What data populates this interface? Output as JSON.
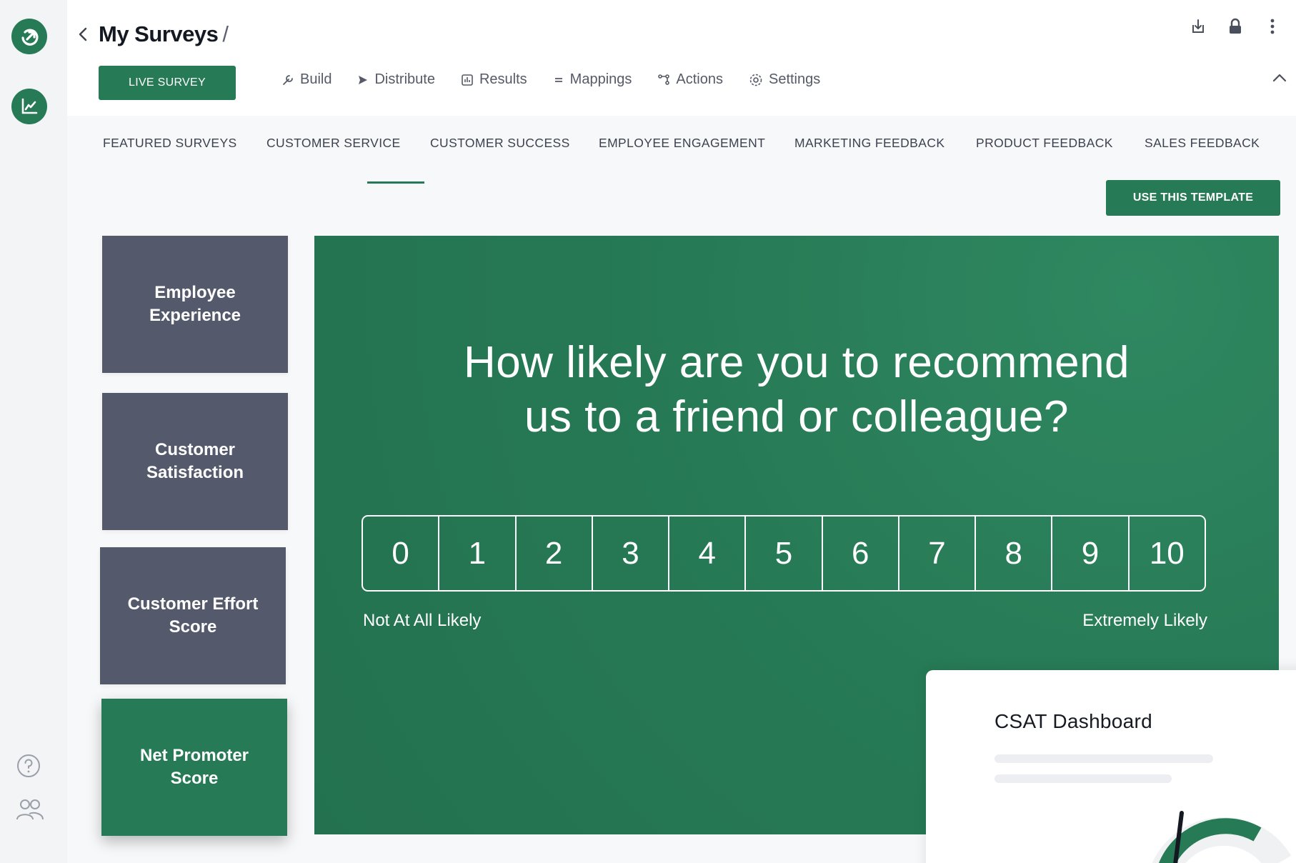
{
  "header": {
    "title": "My Surveys",
    "title_separator": "/",
    "live_button": "LIVE SURVEY",
    "toolbar": [
      {
        "label": "Build",
        "icon": "wrench-icon"
      },
      {
        "label": "Distribute",
        "icon": "send-icon"
      },
      {
        "label": "Results",
        "icon": "results-icon"
      },
      {
        "label": "Mappings",
        "icon": "list-icon"
      },
      {
        "label": "Actions",
        "icon": "workflow-icon"
      },
      {
        "label": "Settings",
        "icon": "gear-icon"
      }
    ],
    "tools": [
      "export-icon",
      "lock-icon",
      "more-vertical-icon"
    ]
  },
  "categories": {
    "tabs": [
      "FEATURED SURVEYS",
      "CUSTOMER SERVICE",
      "CUSTOMER SUCCESS",
      "EMPLOYEE ENGAGEMENT",
      "MARKETING FEEDBACK",
      "PRODUCT FEEDBACK",
      "SALES FEEDBACK"
    ],
    "use_template_button": "USE THIS TEMPLATE"
  },
  "templates": [
    {
      "label": "Employee Experience"
    },
    {
      "label": "Customer Satisfaction"
    },
    {
      "label": "Customer Effort Score"
    },
    {
      "label": "Net Promoter Score",
      "selected": true
    }
  ],
  "preview": {
    "question_line1": "How likely are you to recommend",
    "question_line2": "us to a friend or colleague?",
    "scale": [
      "0",
      "1",
      "2",
      "3",
      "4",
      "5",
      "6",
      "7",
      "8",
      "9",
      "10"
    ],
    "low_label": "Not At All Likely",
    "high_label": "Extremely Likely"
  },
  "csat_card": {
    "title": "CSAT Dashboard"
  },
  "colors": {
    "brand_green": "#267a55",
    "card_slate": "#545a6c",
    "page_bg": "#f7f8f9"
  }
}
